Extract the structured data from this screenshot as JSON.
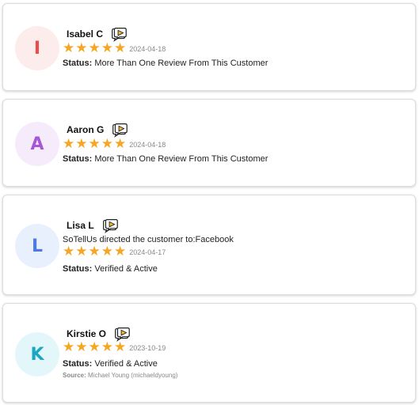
{
  "colors": {
    "star": "#f5a623",
    "avatar_red_bg": "#fdecec",
    "avatar_red_fg": "#e84c4c",
    "avatar_purple_bg": "#f5ebfb",
    "avatar_purple_fg": "#a855d6",
    "avatar_blue_bg": "#e9f0fd",
    "avatar_blue_fg": "#4c7ae0",
    "avatar_cyan_bg": "#e3f7fb",
    "avatar_cyan_fg": "#1ba6c2"
  },
  "status_label": "Status:",
  "source_label": "Source:",
  "reviews": [
    {
      "initial": "I",
      "name": "Isabel C",
      "badge_icon": "review-bubble-icon",
      "rating": 5,
      "date": "2024-04-18",
      "status": "More Than One Review From This Customer"
    },
    {
      "initial": "A",
      "name": "Aaron G",
      "badge_icon": "review-bubble-icon",
      "rating": 5,
      "date": "2024-04-18",
      "status": "More Than One Review From This Customer"
    },
    {
      "initial": "L",
      "name": "Lisa L",
      "badge_icon": "review-bubble-icon",
      "redirect": "SoTellUs directed the customer to:Facebook",
      "rating": 5,
      "date": "2024-04-17",
      "status": "Verified & Active"
    },
    {
      "initial": "K",
      "name": "Kirstie O",
      "badge_icon": "review-bubble-icon",
      "rating": 5,
      "date": "2023-10-19",
      "status": "Verified & Active",
      "source": "Michael Young (michaeldyoung)"
    }
  ]
}
